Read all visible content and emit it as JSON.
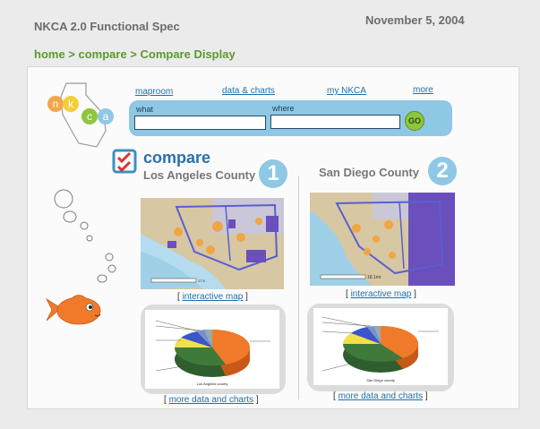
{
  "doc": {
    "title": "NKCA 2.0 Functional Spec",
    "date": "November 5, 2004",
    "breadcrumb": "home > compare > Compare Display"
  },
  "nav": [
    {
      "label": "maproom"
    },
    {
      "label": "data & charts"
    },
    {
      "label": "my NKCA"
    },
    {
      "label": "more"
    }
  ],
  "search": {
    "what_label": "what",
    "where_label": "where",
    "go_label": "GO",
    "what_value": "",
    "where_value": ""
  },
  "logo": {
    "letters": [
      "n",
      "k",
      "c",
      "a"
    ]
  },
  "compare": {
    "heading": "compare",
    "items": [
      {
        "badge": "1",
        "county": "Los Angeles County",
        "map_link": "interactive map",
        "data_link": "more data and charts",
        "scale": "17.5",
        "chart_caption": "Los Angeles county"
      },
      {
        "badge": "2",
        "county": "San Diego County",
        "map_link": "interactive map",
        "data_link": "more data and charts",
        "scale": "18.1mi",
        "chart_caption": "San Diego county"
      }
    ]
  },
  "colors": {
    "link": "#1f6fa8",
    "badge": "#8ec8e4",
    "breadcrumb": "#5c9a2c",
    "fish": "#f07a2a",
    "logo_n": "#f4a64a",
    "logo_k": "#f2cf3a",
    "logo_c": "#8ec63f",
    "logo_a": "#8ec8e4"
  }
}
